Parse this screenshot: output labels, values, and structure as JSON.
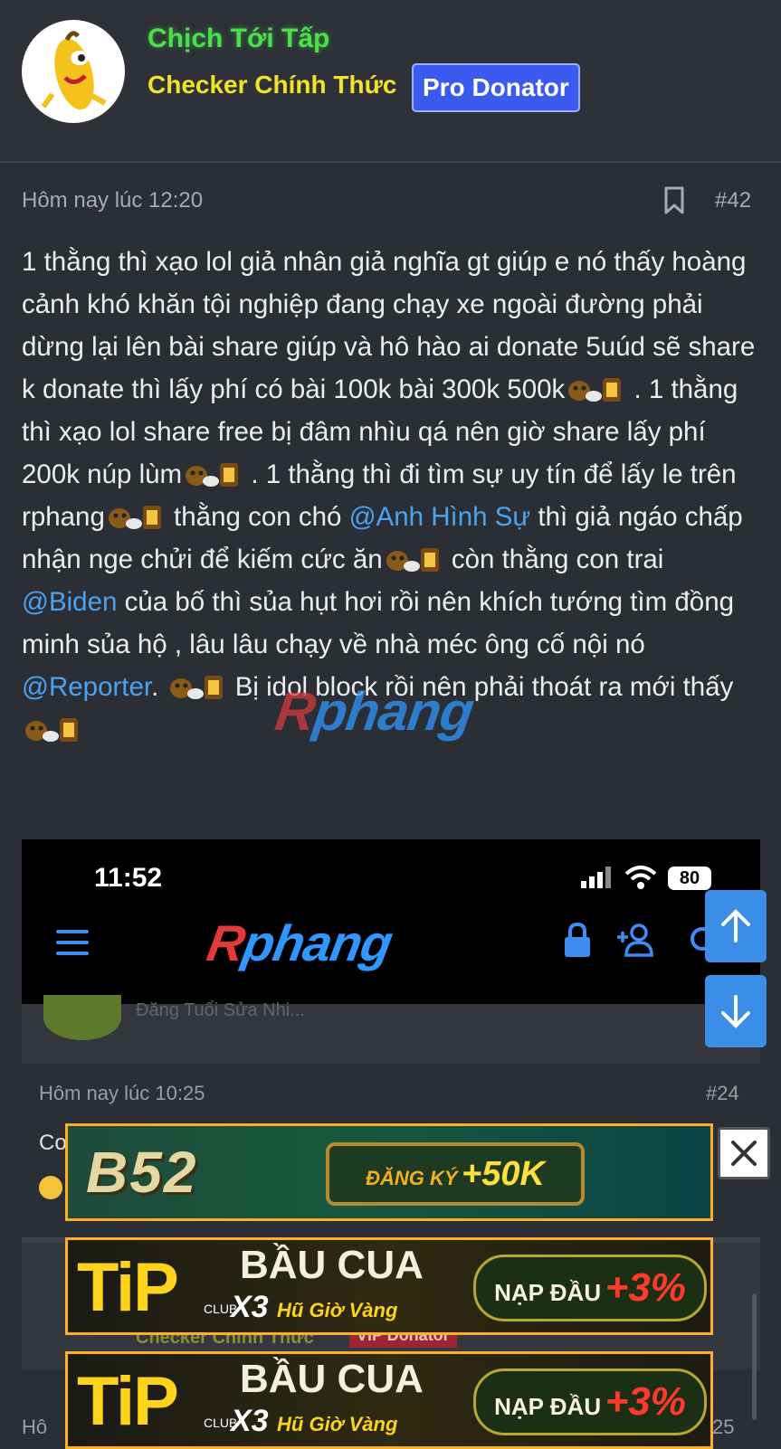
{
  "header": {
    "username": "Chịch Tới Tấp",
    "user_title": "Checker Chính Thức",
    "badge": "Pro Donator"
  },
  "post": {
    "timestamp": "Hôm nay lúc 12:20",
    "number": "#42",
    "segments": [
      {
        "t": "1 thằng thì xạo lol giả nhân giả nghĩa gt giúp e nó thấy hoàng cảnh khó khăn tội nghiệp đang chạy xe ngoài đường phải dừng lại lên bài share giúp và hô hào ai donate 5uúd sẽ share k donate thì lấy phí có bài 100k bài 300k 500k"
      },
      {
        "t": " . 1 thằng thì xạo lol share free bị đâm nhìu qá nên giờ share lấy phí 200k núp lùm"
      },
      {
        "t": " . 1 thằng thì đi tìm sự uy tín để lấy le trên rphang"
      },
      {
        "t": " thằng con chó "
      },
      {
        "m": "@Anh Hình Sự"
      },
      {
        "t": " thì giả ngáo chấp nhận nge chửi để kiếm cức ăn"
      },
      {
        "t": " còn thằng con trai "
      },
      {
        "m": "@Biden"
      },
      {
        "t": " của bố thì sủa hụt hơi rồi nên khích tướng tìm đồng minh sủa hộ , lâu lâu chạy về nhà méc ông cố nội nó "
      },
      {
        "m": "@Reporter"
      },
      {
        "t": ". "
      },
      {
        "t": " Bị idol block rồi nên phải thoát ra mới thấy"
      }
    ],
    "emoji_name": "bear-money-emoji",
    "watermark_a": "R",
    "watermark_b": "phang"
  },
  "screenshot": {
    "time": "11:52",
    "battery": "80",
    "logo_a": "R",
    "logo_b": "phang"
  },
  "second_post": {
    "faded_text": "Đăng Tuổi Sửa Nhi...",
    "timestamp": "Hôm nay lúc 10:25",
    "number": "#24",
    "text": "Co"
  },
  "third_post": {
    "title": "Checker Chính Thức",
    "badge": "VIP Donator",
    "timestamp_fragment": "Hô",
    "number_fragment": "25"
  },
  "ads": {
    "b52_logo": "B52",
    "b52_cta_a": "ĐĂNG KÝ",
    "b52_cta_b": "+50K",
    "tip_logo": "TiP",
    "tip_club": "CLUB",
    "tip_head": "BẦU CUA",
    "tip_sub_a": "X3",
    "tip_sub_b": "Hũ Giờ Vàng",
    "tip_cta_a": "NẠP ĐẦU",
    "tip_cta_b": "+3%"
  },
  "colors": {
    "background": "#2b2e35",
    "username": "#49e04a",
    "user_title": "#f2e324",
    "badge": "#3b5af0",
    "mention": "#4aa3f0",
    "scroll_button": "#3b8ee8"
  }
}
